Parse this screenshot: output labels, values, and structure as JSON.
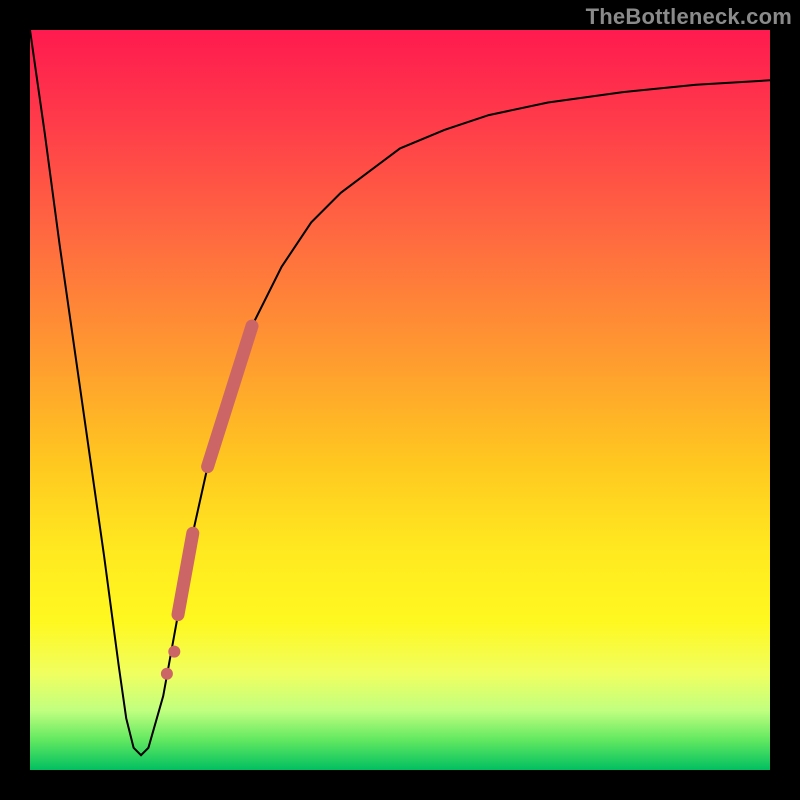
{
  "watermark": "TheBottleneck.com",
  "colors": {
    "frame": "#000000",
    "curve": "#000000",
    "marker": "#cc6666",
    "gradient_top": "#ff1a4f",
    "gradient_bottom": "#00c060"
  },
  "chart_data": {
    "type": "line",
    "title": "",
    "xlabel": "",
    "ylabel": "",
    "xlim": [
      0,
      100
    ],
    "ylim": [
      0,
      100
    ],
    "grid": false,
    "legend": false,
    "series": [
      {
        "name": "bottleneck-curve",
        "x": [
          0,
          2,
          4,
          6,
          8,
          10,
          12,
          13,
          14,
          15,
          16,
          18,
          20,
          22,
          24,
          26,
          28,
          30,
          34,
          38,
          42,
          46,
          50,
          56,
          62,
          70,
          80,
          90,
          100
        ],
        "values": [
          100,
          86,
          71,
          57,
          43,
          29,
          14,
          7,
          3,
          2,
          3,
          10,
          21,
          32,
          41,
          49,
          55,
          60,
          68,
          74,
          78,
          81,
          84,
          86.5,
          88.5,
          90.2,
          91.6,
          92.6,
          93.2
        ]
      }
    ],
    "markers": [
      {
        "name": "highlight-segment-upper",
        "x_start": 24,
        "y_start": 41,
        "x_end": 30,
        "y_end": 60,
        "thick": true
      },
      {
        "name": "highlight-dot-1",
        "x": 18.5,
        "y": 13
      },
      {
        "name": "highlight-dot-2",
        "x": 19.5,
        "y": 16
      },
      {
        "name": "highlight-segment-lower",
        "x_start": 20,
        "y_start": 21,
        "x_end": 22,
        "y_end": 32,
        "thick": true
      }
    ]
  }
}
